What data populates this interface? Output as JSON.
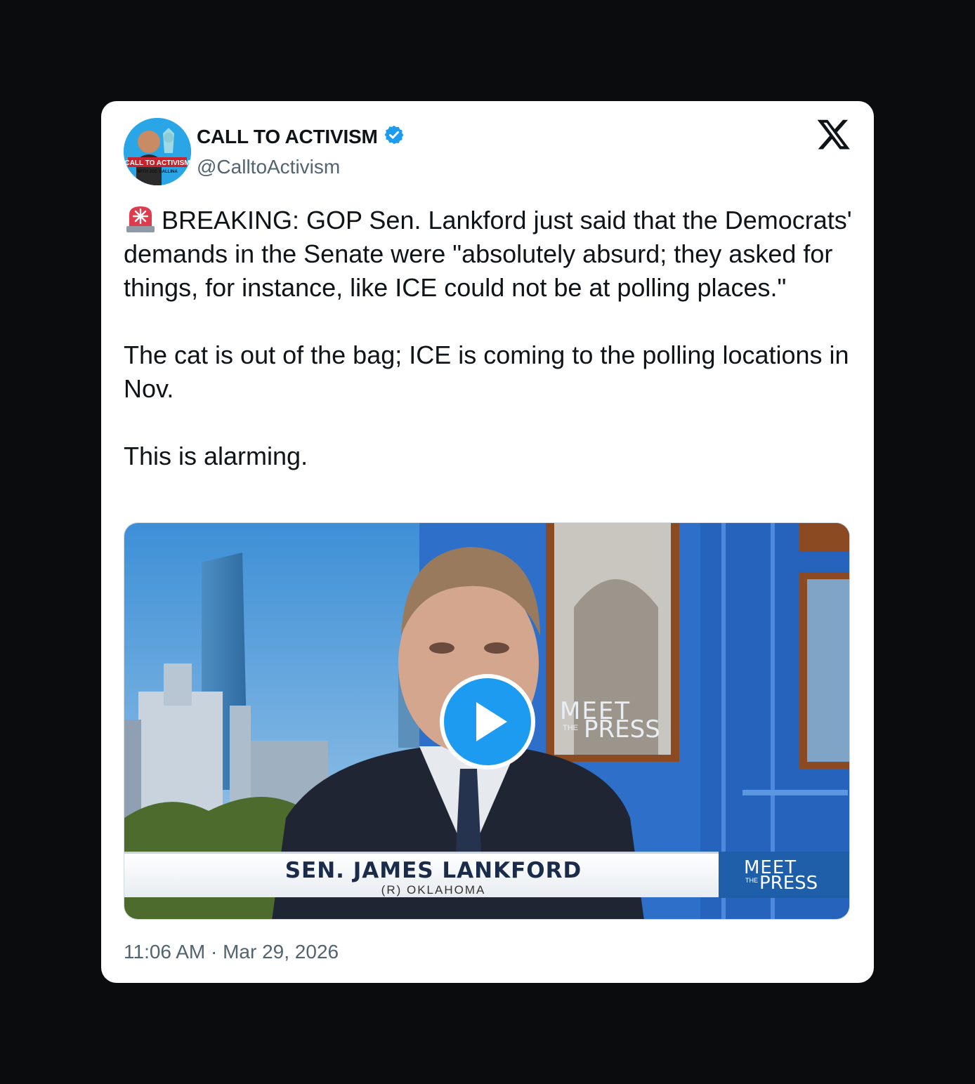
{
  "author": {
    "name": "CALL TO ACTIVISM",
    "handle": "@CalltoActivism",
    "verified": true,
    "avatar_text": "CALL TO ACTIVISM",
    "avatar_subtext": "WITH JOE GALLINA"
  },
  "tweet": {
    "emoji": "rotating-light",
    "text": "BREAKING: GOP Sen. Lankford just said that the Democrats' demands in the Senate were \"absolutely absurd; they asked for things, for instance, like ICE could not be at polling places.\"\n\nThe cat is out of the bag; ICE is coming to the polling locations in Nov.\n\nThis is alarming."
  },
  "video": {
    "lower_third_name": "SEN. JAMES LANKFORD",
    "lower_third_sub": "(R) OKLAHOMA",
    "show_meet": "MEET",
    "show_the": "THE",
    "show_press": "PRESS"
  },
  "timestamp": "11:06 AM · Mar 29, 2026",
  "colors": {
    "accent": "#1d9bf0",
    "text": "#0f1419",
    "muted": "#536471",
    "background": "#0b0c0d"
  }
}
